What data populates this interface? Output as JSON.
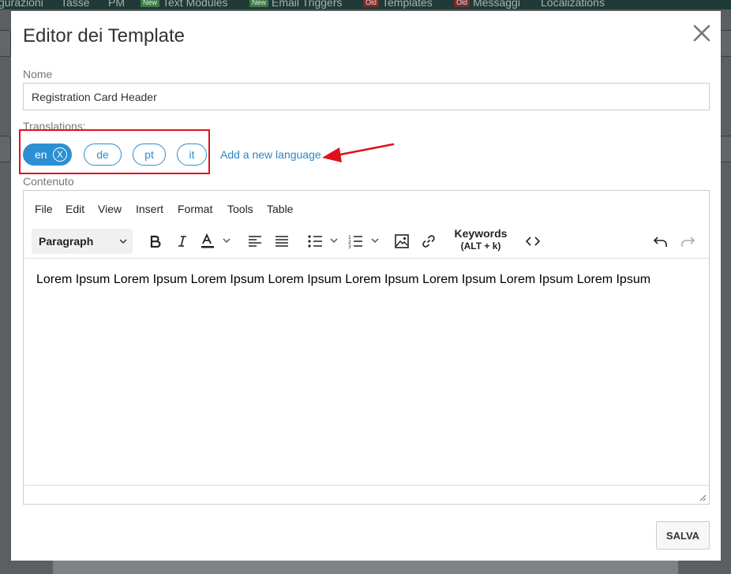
{
  "background": {
    "nav_items": [
      {
        "label": "gurazioni",
        "tag": ""
      },
      {
        "label": "Tasse",
        "tag": ""
      },
      {
        "label": "PM",
        "tag": ""
      },
      {
        "label": "Text Modules",
        "tag": "New"
      },
      {
        "label": "Email Triggers",
        "tag": "New"
      },
      {
        "label": "Templates",
        "tag": "Old"
      },
      {
        "label": "Messaggi",
        "tag": "Old"
      },
      {
        "label": "Localizations",
        "tag": ""
      }
    ]
  },
  "modal": {
    "title": "Editor dei Template",
    "close_icon": "close-icon",
    "name_label": "Nome",
    "name_value": "Registration Card Header",
    "translations_label": "Translations:",
    "languages": [
      {
        "code": "en",
        "active": true,
        "remove_symbol": "X"
      },
      {
        "code": "de",
        "active": false
      },
      {
        "code": "pt",
        "active": false
      },
      {
        "code": "it",
        "active": false
      }
    ],
    "add_language_label": "Add a new language",
    "content_label": "Contenuto",
    "editor": {
      "menu": [
        "File",
        "Edit",
        "View",
        "Insert",
        "Format",
        "Tools",
        "Table"
      ],
      "block_format": "Paragraph",
      "keywords_label": "Keywords",
      "keywords_shortcut": "(ALT + k)",
      "content_text": "Lorem Ipsum Lorem Ipsum Lorem Ipsum Lorem Ipsum Lorem Ipsum Lorem Ipsum Lorem Ipsum Lorem Ipsum"
    },
    "save_label": "SALVA"
  },
  "colors": {
    "accent": "#2c8fd3",
    "link": "#2a86c5",
    "annotation_red": "#e0101b"
  }
}
